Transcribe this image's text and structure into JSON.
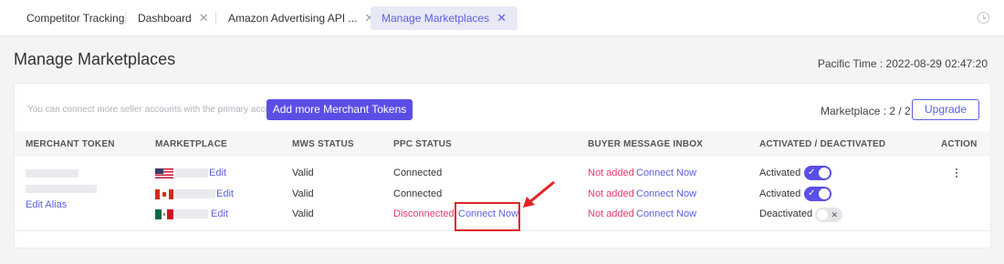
{
  "tabs": [
    {
      "label": "Competitor Tracking",
      "closable": false,
      "active": false
    },
    {
      "label": "Dashboard",
      "closable": true,
      "active": false
    },
    {
      "label": "Amazon Advertising API ...",
      "closable": true,
      "active": false
    },
    {
      "label": "Manage Marketplaces",
      "closable": true,
      "active": true
    }
  ],
  "tab_close_glyph": "✕",
  "page": {
    "title": "Manage Marketplaces",
    "pacific_time": "Pacific Time : 2022-08-29 02:47:20"
  },
  "card": {
    "hint": "You can connect more seller accounts with the primary account",
    "add_button": "Add more Merchant Tokens",
    "marketplace_count": "Marketplace : 2 / 2",
    "upgrade_button": "Upgrade"
  },
  "table": {
    "headers": [
      "MERCHANT TOKEN",
      "MARKETPLACE",
      "MWS STATUS",
      "PPC STATUS",
      "BUYER MESSAGE INBOX",
      "ACTIVATED / DEACTIVATED",
      "ACTION"
    ],
    "edit_alias": "Edit Alias",
    "rows": [
      {
        "flag": "us-flag-icon",
        "edit": "Edit",
        "mws": "Valid",
        "ppc": "Connected",
        "ppc_state": "connected",
        "ppc_action": "",
        "inbox_status": "Not added",
        "inbox_action": "Connect Now",
        "activation": "Activated",
        "toggle_on": true
      },
      {
        "flag": "ca-flag-icon",
        "edit": "Edit",
        "mws": "Valid",
        "ppc": "Connected",
        "ppc_state": "connected",
        "ppc_action": "",
        "inbox_status": "Not added",
        "inbox_action": "Connect Now",
        "activation": "Activated",
        "toggle_on": true
      },
      {
        "flag": "mx-flag-icon",
        "edit": "Edit",
        "mws": "Valid",
        "ppc": "Disconnected",
        "ppc_state": "disconnected",
        "ppc_action": "Connect Now",
        "inbox_status": "Not added",
        "inbox_action": "Connect Now",
        "activation": "Deactivated",
        "toggle_on": false
      }
    ]
  },
  "icons": {
    "toggle_on": "✓",
    "toggle_off": "✕",
    "clock": "clock-icon",
    "more": "more-vertical-icon"
  },
  "colors": {
    "accent": "#5b4ee6",
    "link": "#5b5fe0",
    "alert": "#e8396a",
    "annotation": "#e02424"
  }
}
